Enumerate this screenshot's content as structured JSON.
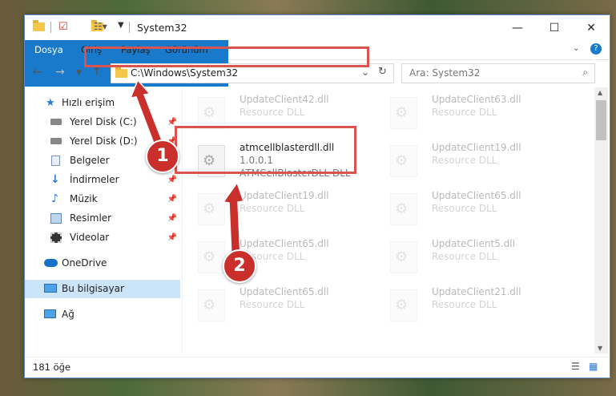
{
  "window": {
    "title": "System32"
  },
  "ribbon": {
    "tabs": [
      "Dosya",
      "Giriş",
      "Paylaş",
      "Görünüm"
    ]
  },
  "address": {
    "path": "C:\\Windows\\System32"
  },
  "search": {
    "placeholder": "Ara: System32"
  },
  "sidebar": {
    "items": [
      {
        "label": "Hızlı erişim",
        "icon": "star-icon"
      },
      {
        "label": "Yerel Disk (C:)",
        "icon": "drive-icon",
        "pinned": true
      },
      {
        "label": "Yerel Disk (D:)",
        "icon": "drive-icon",
        "pinned": true
      },
      {
        "label": "Belgeler",
        "icon": "documents-icon",
        "pinned": true
      },
      {
        "label": "İndirmeler",
        "icon": "download-icon",
        "pinned": true
      },
      {
        "label": "Müzik",
        "icon": "music-icon",
        "pinned": true
      },
      {
        "label": "Resimler",
        "icon": "pictures-icon",
        "pinned": true
      },
      {
        "label": "Videolar",
        "icon": "videos-icon",
        "pinned": true
      },
      {
        "label": "OneDrive",
        "icon": "cloud-icon"
      },
      {
        "label": "Bu bilgisayar",
        "icon": "computer-icon",
        "selected": true
      },
      {
        "label": "Ağ",
        "icon": "network-icon"
      }
    ]
  },
  "files": {
    "left": [
      {
        "name": "UpdateClient42.dll",
        "type": "Resource DLL"
      },
      {
        "name": "atmcellblasterdll.dll",
        "version": "1.0.0.1",
        "type": "ATMCellBlasterDLL DLL"
      },
      {
        "name": "UpdateClient19.dll",
        "type": "Resource DLL"
      },
      {
        "name": "UpdateClient65.dll",
        "type": "Resource DLL"
      },
      {
        "name": "UpdateClient65.dll",
        "type": "Resource DLL"
      }
    ],
    "right": [
      {
        "name": "UpdateClient63.dll",
        "type": "Resource DLL"
      },
      {
        "name": "UpdateClient19.dll",
        "type": "Resource DLL"
      },
      {
        "name": "UpdateClient65.dll",
        "type": "Resource DLL"
      },
      {
        "name": "UpdateClient5.dll",
        "type": "Resource DLL"
      },
      {
        "name": "UpdateClient21.dll",
        "type": "Resource DLL"
      }
    ]
  },
  "status": {
    "count": "181 öğe"
  },
  "annotations": {
    "step1": "1",
    "step2": "2",
    "color": "#c9302c"
  }
}
